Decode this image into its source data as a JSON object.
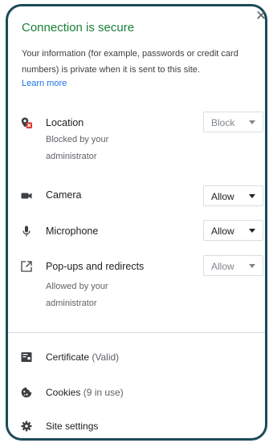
{
  "header": {
    "title": "Connection is secure",
    "description": "Your information (for example, passwords or credit card numbers) is private when it is sent to this site.",
    "learn_more": "Learn more",
    "close_icon": "close-icon"
  },
  "permissions": [
    {
      "label": "Location",
      "icon": "location-blocked-icon",
      "value": "Block",
      "note": "Blocked by your administrator",
      "disabled": true
    },
    {
      "label": "Camera",
      "icon": "camera-icon",
      "value": "Allow",
      "note": "",
      "disabled": false
    },
    {
      "label": "Microphone",
      "icon": "microphone-icon",
      "value": "Allow",
      "note": "",
      "disabled": false
    },
    {
      "label": "Pop-ups and redirects",
      "icon": "popup-icon",
      "value": "Allow",
      "note": "Allowed by your administrator",
      "disabled": true
    }
  ],
  "footer": {
    "certificate_label": "Certificate",
    "certificate_status": "(Valid)",
    "cookies_label": "Cookies",
    "cookies_status": "(9 in use)",
    "site_settings_label": "Site settings"
  },
  "colors": {
    "secure_green": "#188038",
    "link_blue": "#1a73e8",
    "frame_border": "#1d4a57",
    "blocked_red": "#d93025"
  }
}
